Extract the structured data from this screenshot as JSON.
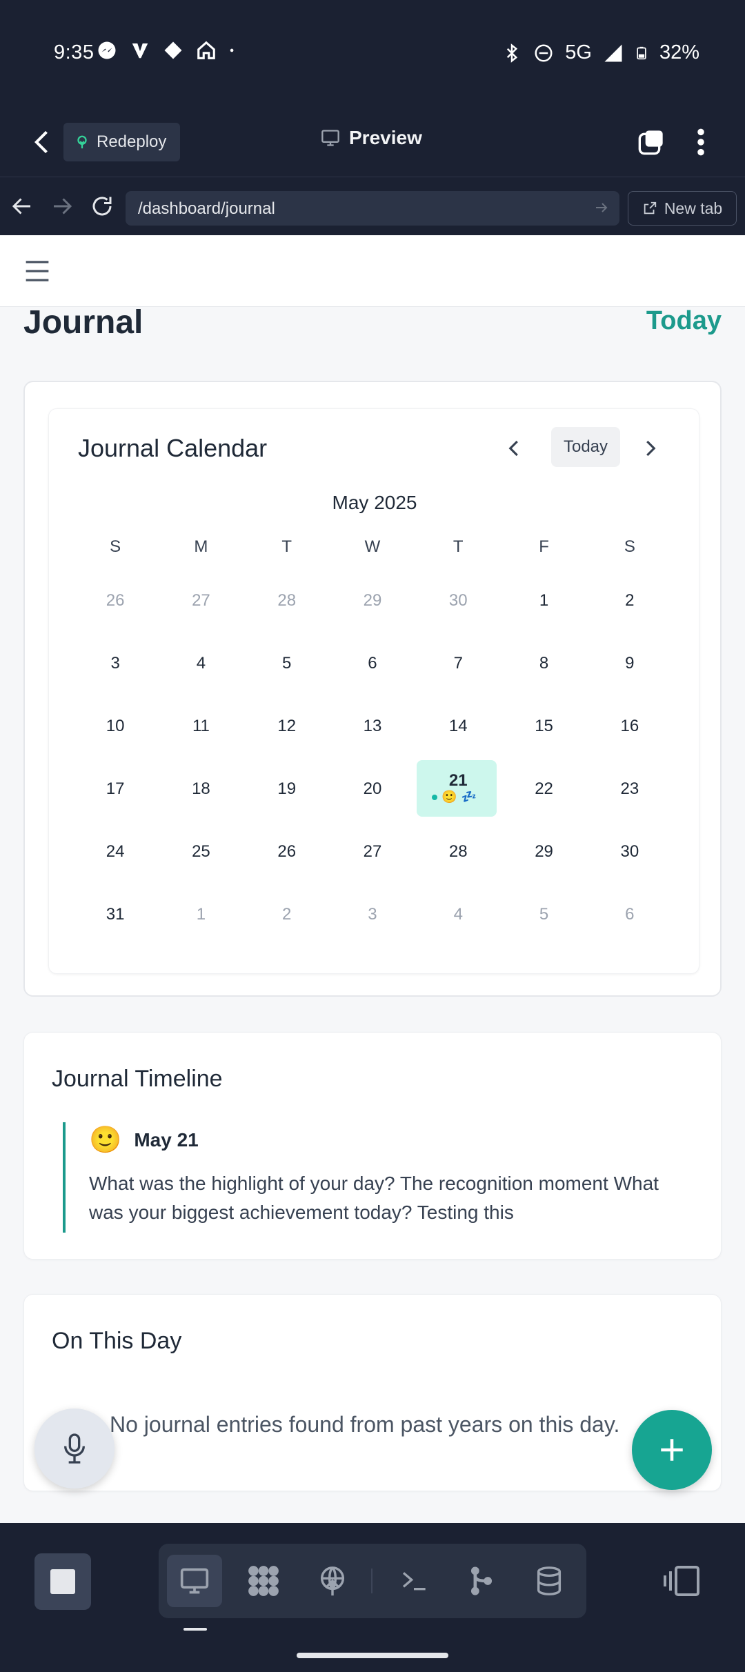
{
  "status_bar": {
    "time": "9:35",
    "network": "5G",
    "battery": "32%"
  },
  "app_bar": {
    "redeploy_label": "Redeploy",
    "preview_label": "Preview"
  },
  "url_bar": {
    "url": "/dashboard/journal",
    "new_tab_label": "New tab"
  },
  "page": {
    "title": "Journal",
    "today_link": "Today"
  },
  "calendar": {
    "title": "Journal Calendar",
    "today_button": "Today",
    "month_label": "May 2025",
    "weekdays": [
      "S",
      "M",
      "T",
      "W",
      "T",
      "F",
      "S"
    ],
    "weeks": [
      [
        {
          "d": "26",
          "m": true
        },
        {
          "d": "27",
          "m": true
        },
        {
          "d": "28",
          "m": true
        },
        {
          "d": "29",
          "m": true
        },
        {
          "d": "30",
          "m": true
        },
        {
          "d": "1"
        },
        {
          "d": "2"
        }
      ],
      [
        {
          "d": "3"
        },
        {
          "d": "4"
        },
        {
          "d": "5"
        },
        {
          "d": "6"
        },
        {
          "d": "7"
        },
        {
          "d": "8"
        },
        {
          "d": "9"
        }
      ],
      [
        {
          "d": "10"
        },
        {
          "d": "11"
        },
        {
          "d": "12"
        },
        {
          "d": "13"
        },
        {
          "d": "14"
        },
        {
          "d": "15"
        },
        {
          "d": "16"
        }
      ],
      [
        {
          "d": "17"
        },
        {
          "d": "18"
        },
        {
          "d": "19"
        },
        {
          "d": "20"
        },
        {
          "d": "21",
          "sel": true
        },
        {
          "d": "22"
        },
        {
          "d": "23"
        }
      ],
      [
        {
          "d": "24"
        },
        {
          "d": "25"
        },
        {
          "d": "26"
        },
        {
          "d": "27"
        },
        {
          "d": "28"
        },
        {
          "d": "29"
        },
        {
          "d": "30"
        }
      ],
      [
        {
          "d": "31"
        },
        {
          "d": "1",
          "m": true
        },
        {
          "d": "2",
          "m": true
        },
        {
          "d": "3",
          "m": true
        },
        {
          "d": "4",
          "m": true
        },
        {
          "d": "5",
          "m": true
        },
        {
          "d": "6",
          "m": true
        }
      ]
    ],
    "selected_marks": {
      "mood_emoji": "🙂",
      "sleep_emoji": "💤"
    }
  },
  "timeline": {
    "title": "Journal Timeline",
    "entry": {
      "emoji": "🙂",
      "date": "May 21",
      "text": "What was the highlight of your day? The recognition moment What was your biggest achievement today? Testing this"
    }
  },
  "on_this_day": {
    "title": "On This Day",
    "empty_message": "No journal entries found from past years on this day."
  },
  "colors": {
    "accent": "#1c9a8c",
    "dark_bg": "#1b2132",
    "selected_day_bg": "#cdf7ed"
  }
}
